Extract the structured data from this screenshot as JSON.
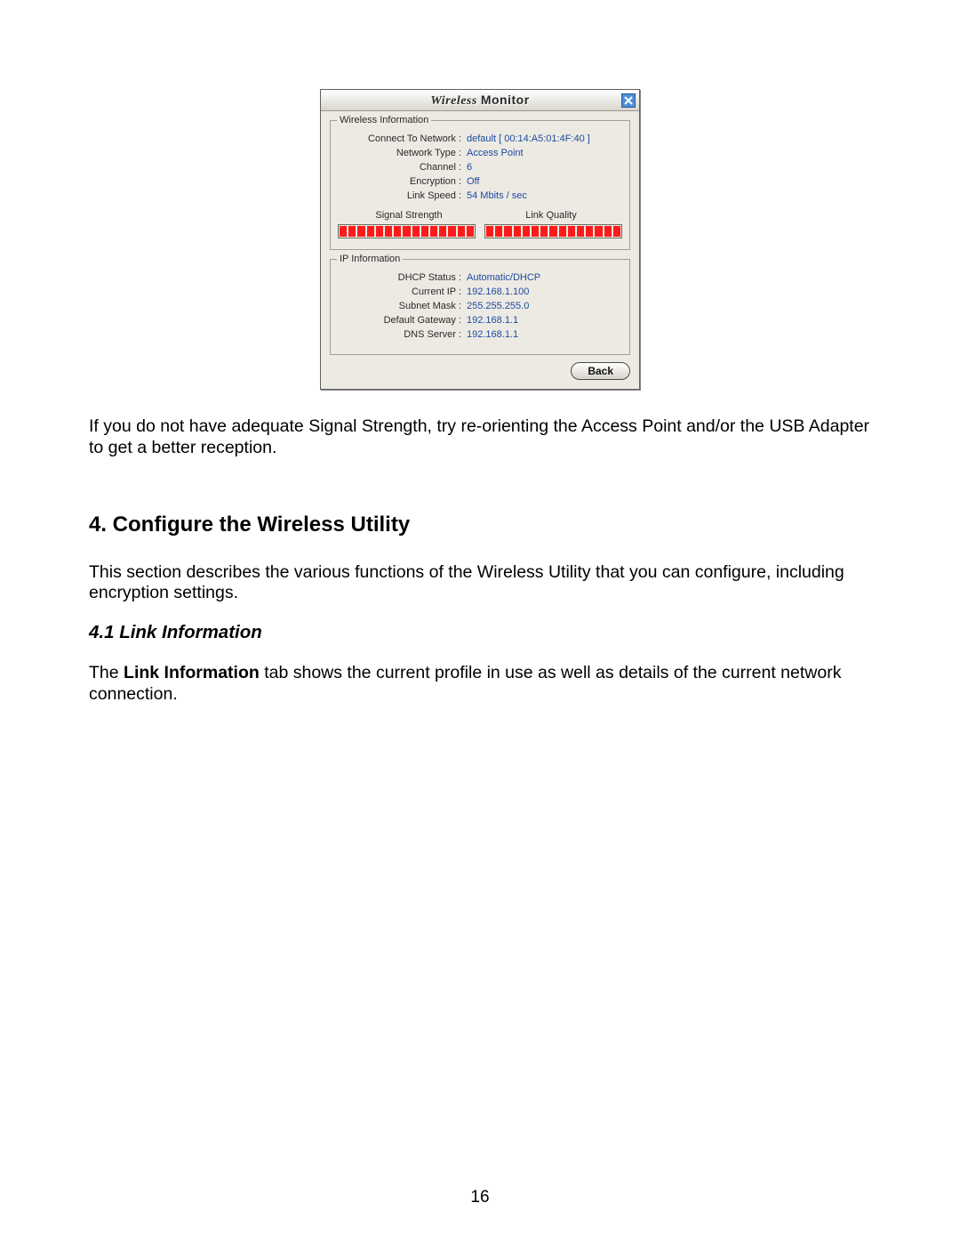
{
  "dialog": {
    "title_a": "Wireless",
    "title_b": "Monitor"
  },
  "wireless_info": {
    "legend": "Wireless Information",
    "connect_to_network_label": "Connect To Network :",
    "connect_to_network_value": "default [ 00:14:A5:01:4F:40 ]",
    "network_type_label": "Network Type :",
    "network_type_value": "Access Point",
    "channel_label": "Channel :",
    "channel_value": "6",
    "encryption_label": "Encryption :",
    "encryption_value": "Off",
    "link_speed_label": "Link Speed :",
    "link_speed_value": "54 Mbits / sec",
    "signal_strength_label": "Signal Strength",
    "link_quality_label": "Link Quality"
  },
  "ip_info": {
    "legend": "IP Information",
    "dhcp_status_label": "DHCP Status :",
    "dhcp_status_value": "Automatic/DHCP",
    "current_ip_label": "Current IP :",
    "current_ip_value": "192.168.1.100",
    "subnet_mask_label": "Subnet Mask :",
    "subnet_mask_value": "255.255.255.0",
    "default_gateway_label": "Default Gateway :",
    "default_gateway_value": "192.168.1.1",
    "dns_server_label": "DNS Server :",
    "dns_server_value": "192.168.1.1"
  },
  "buttons": {
    "back": "Back"
  },
  "doc": {
    "para1": "If you do not have adequate Signal Strength, try re-orienting the Access Point and/or the USB Adapter to get a better reception.",
    "h2": "4. Configure the Wireless Utility",
    "para2": "This section describes the various functions of the Wireless Utility that you can configure, including encryption settings.",
    "h3": "4.1 Link Information",
    "para3_a": "The ",
    "para3_b": "Link Information",
    "para3_c": " tab shows the current profile in use as well as details of the current network connection.",
    "page_number": "16"
  }
}
